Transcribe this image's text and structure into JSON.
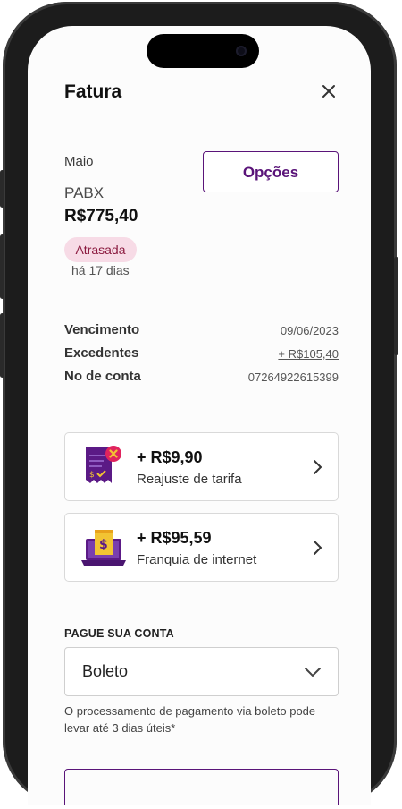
{
  "header": {
    "title": "Fatura",
    "close_icon": "close-icon"
  },
  "invoice": {
    "month": "Maio",
    "product": "PABX",
    "amount": "R$775,40",
    "status_badge": "Atrasada",
    "overdue_text": "há 17 dias",
    "options_label": "Opções"
  },
  "details": [
    {
      "label": "Vencimento",
      "value": "09/06/2023"
    },
    {
      "label": "Excedentes",
      "value": "+ R$105,40"
    },
    {
      "label": "No de conta",
      "value": "07264922615399"
    }
  ],
  "cards": [
    {
      "amount": "+ R$9,90",
      "description": "Reajuste de tarifa",
      "icon": "receipt-warning-icon"
    },
    {
      "amount": "+ R$95,59",
      "description": "Franquia de internet",
      "icon": "laptop-bill-icon"
    }
  ],
  "payment": {
    "heading": "PAGUE SUA CONTA",
    "method_selected": "Boleto",
    "note": "O processamento de pagamento via boleto pode levar até 3 dias úteis*"
  },
  "colors": {
    "accent": "#5a1479",
    "badge_bg": "#f7dbe6",
    "badge_text": "#8b1a3f",
    "icon_purple": "#5b1a86",
    "icon_yellow": "#f2c433",
    "icon_red": "#e0245e"
  }
}
